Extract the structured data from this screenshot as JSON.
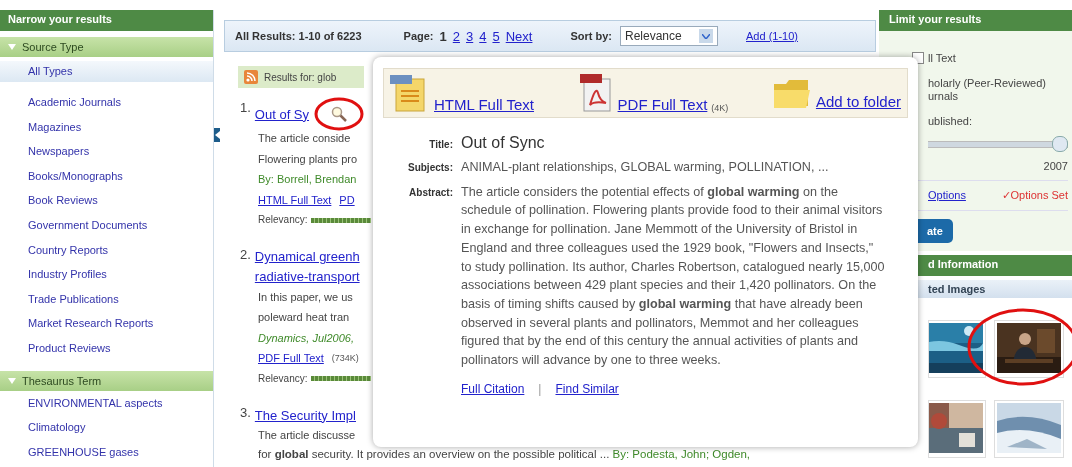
{
  "sidebar_left": {
    "title": "Narrow your results",
    "groups": [
      {
        "label": "Source Type",
        "expanded": true,
        "items": [
          {
            "label": "All Types",
            "selected": true
          },
          {
            "label": "Academic Journals",
            "selected": false
          },
          {
            "label": "Magazines",
            "selected": false
          },
          {
            "label": "Newspapers",
            "selected": false
          },
          {
            "label": "Books/Monographs",
            "selected": false
          },
          {
            "label": "Book Reviews",
            "selected": false
          },
          {
            "label": "Government Documents",
            "selected": false
          },
          {
            "label": "Country Reports",
            "selected": false
          },
          {
            "label": "Industry Profiles",
            "selected": false
          },
          {
            "label": "Trade Publications",
            "selected": false
          },
          {
            "label": "Market Research Reports",
            "selected": false
          },
          {
            "label": "Product Reviews",
            "selected": false
          }
        ]
      },
      {
        "label": "Thesaurus Term",
        "expanded": true,
        "items": [
          {
            "label": "ENVIRONMENTAL aspects",
            "selected": false
          },
          {
            "label": "Climatology",
            "selected": false
          },
          {
            "label": "GREENHOUSE gases",
            "selected": false
          }
        ]
      }
    ]
  },
  "results_bar": {
    "summary": "All Results: 1-10 of 6223",
    "page_label": "Page:",
    "pages": [
      {
        "label": "1",
        "selected": true
      },
      {
        "label": "2",
        "selected": false
      },
      {
        "label": "3",
        "selected": false
      },
      {
        "label": "4",
        "selected": false
      },
      {
        "label": "5",
        "selected": false
      }
    ],
    "next": "Next",
    "sort_label": "Sort by:",
    "sort_value": "Relevance",
    "add": "Add (1-10)"
  },
  "results_for": "Results for: glob",
  "results": [
    {
      "number": "1.",
      "title_lines": [
        "Out of Sy"
      ],
      "preview_icon": true,
      "circled": true,
      "lines": [
        {
          "kind": "text",
          "text": "The article conside"
        },
        {
          "kind": "text",
          "text": "Flowering plants pro"
        },
        {
          "kind": "byline",
          "text": "By: Borrell, Brendan"
        },
        {
          "kind": "links",
          "links": [
            "HTML Full Text",
            "PD"
          ]
        },
        {
          "kind": "relevancy",
          "text": "Relevancy:"
        }
      ]
    },
    {
      "number": "2.",
      "title_lines": [
        "Dynamical greenh",
        "radiative-transport"
      ],
      "preview_icon": false,
      "circled": false,
      "lines": [
        {
          "kind": "text",
          "text": "In this paper, we us"
        },
        {
          "kind": "text",
          "text": "poleward heat tran"
        },
        {
          "kind": "source",
          "text": "Dynamics, Jul2006,"
        },
        {
          "kind": "links",
          "links": [
            "PDF Full Text"
          ],
          "size": "(734K)"
        },
        {
          "kind": "relevancy",
          "text": "Relevancy:"
        }
      ]
    },
    {
      "number": "3.",
      "title_lines": [
        "The Security Impl"
      ],
      "preview_icon": false,
      "circled": false,
      "lines": [
        {
          "kind": "text",
          "text": "The article discusse"
        },
        {
          "kind": "text_byline",
          "text": "for **global** security. It provides an overview on the possible political ...",
          "byline": "By: Podesta, John; Ogden,"
        }
      ]
    }
  ],
  "popup": {
    "actions": [
      {
        "kind": "html",
        "label": "HTML Full Text"
      },
      {
        "kind": "pdf",
        "label": "PDF Full Text",
        "size": "(4K)"
      },
      {
        "kind": "folder",
        "label": "Add to folder"
      }
    ],
    "fields": [
      {
        "kind": "title",
        "label": "Title:",
        "value": "Out of Sync"
      },
      {
        "kind": "text",
        "label": "Subjects:",
        "value": "ANIMAL-plant relationships, GLOBAL warming, POLLINATION, ..."
      },
      {
        "kind": "text",
        "label": "Abstract:",
        "value": "The article considers the potential effects of **global warming** on the schedule of pollination. Flowering plants provide food to their animal visitors in exchange for pollination. Jane Memmott of the University of Bristol in England and three colleagues used the 1929 book, \"Flowers and Insects,\" to study pollination. Its author, Charles Robertson, catalogued nearly 15,000 associations between 429 plant species and their 1,420 pollinators. On the basis of timing shifts caused by **global warming** that have already been observed in several plants and pollinators, Memmot and her colleagues figured that by the end of this century the annual activities of plants and pollinators will advance by one to three weeks."
      }
    ],
    "links": [
      "Full Citation",
      "Find Similar"
    ],
    "separator": "|"
  },
  "sidebar_right": {
    "title": "Limit your results",
    "full_text": {
      "label": "ll Text",
      "checked": false
    },
    "scholarly_lines": [
      "holarly (Peer-Reviewed)",
      "urnals"
    ],
    "published_label": "ublished:",
    "slider": {
      "level": 1,
      "reading": "2007"
    },
    "options_link": "Options",
    "options_set": "✓Options Set",
    "update_button": "ate",
    "info_title": "d Information",
    "images_title": "ted Images",
    "images": [
      {
        "kind": "picture",
        "circled": false
      },
      {
        "kind": "picture",
        "circled": true
      },
      {
        "kind": "picture",
        "circled": false
      },
      {
        "kind": "picture",
        "circled": false
      }
    ]
  }
}
